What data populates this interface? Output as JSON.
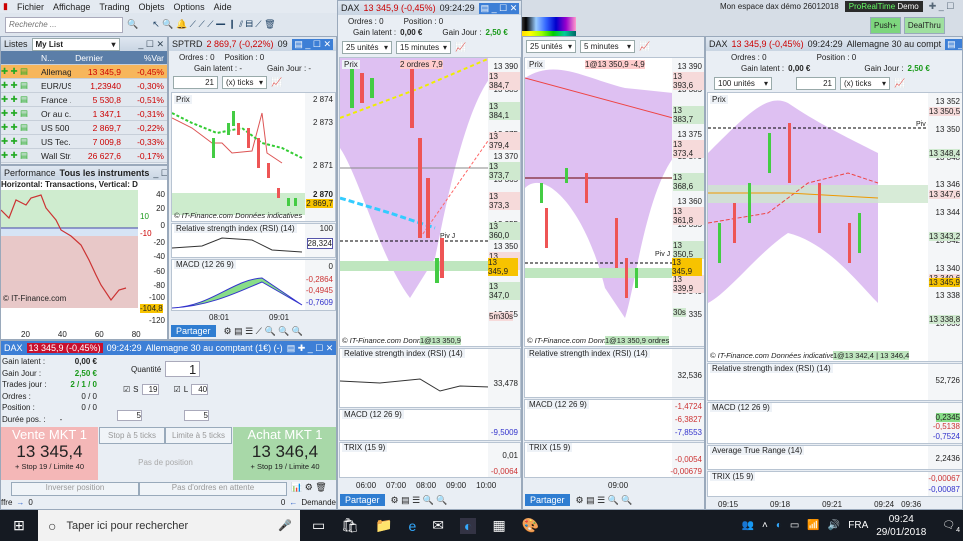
{
  "menu": [
    "Fichier",
    "Affichage",
    "Trading",
    "Objets",
    "Options",
    "Aide"
  ],
  "search": {
    "placeholder": "Recherche ..."
  },
  "workspace": {
    "title": "Mon espace dax démo 26012018",
    "brand": "ProRealTime",
    "mode": "Demo",
    "push": "Push+",
    "dealthru": "DealThru"
  },
  "watchlist": {
    "label": "Listes",
    "name": "My List",
    "cols": [
      "N...",
      "Dernier",
      "%Var"
    ],
    "rows": [
      {
        "n": "Allemag...",
        "last": "13 345,9",
        "var": "-0,45%"
      },
      {
        "n": "EUR/US...",
        "last": "1,23940",
        "var": "-0,30%"
      },
      {
        "n": "France ...",
        "last": "5 530,8",
        "var": "-0,51%"
      },
      {
        "n": "Or au c...",
        "last": "1 347,1",
        "var": "-0,31%"
      },
      {
        "n": "US 500 ...",
        "last": "2 869,7",
        "var": "-0,22%"
      },
      {
        "n": "US Tec...",
        "last": "7 009,8",
        "var": "-0,33%"
      },
      {
        "n": "Wall Str...",
        "last": "26 627,6",
        "var": "-0,17%"
      }
    ]
  },
  "sptrd": {
    "symbol": "SPTRD",
    "price": "2 869,7 (-0,22%)",
    "time": "09",
    "ordres": "Ordres : 0",
    "ordres2": "/ 0",
    "position": "Position : 0",
    "position2": "/ 0",
    "gain_latent": "Gain latent : -",
    "gain_jour": "Gain Jour : -",
    "units": "21",
    "mode": "(x) ticks",
    "prix": "Prix",
    "axis": [
      "2 874",
      "2 873",
      "2 871",
      "2 870",
      "2 869"
    ],
    "last": "2 869,7",
    "copyright": "© IT-Finance.com Données indicatives",
    "rsi": "Relative strength index (RSI) (14)",
    "rsi_axis": [
      "100",
      "50",
      "0"
    ],
    "rsi_val": "28,324",
    "macd": "MACD (12 26 9)",
    "macd_vals": [
      "0",
      "-0,2864",
      "-0,4945",
      "-0,7609"
    ],
    "x": [
      "08:01",
      "09:01"
    ],
    "share": "Partager"
  },
  "perf": {
    "tab": "Performance",
    "filter": "Tous les instruments",
    "title": "Horizontal: Transactions, Vertical: Devise (€)",
    "y": [
      "40",
      "20",
      "0",
      "-20",
      "-40",
      "-60",
      "-80",
      "-100",
      "-120"
    ],
    "x": [
      "20",
      "40",
      "60",
      "80"
    ],
    "last": "-104,8",
    "v1": "10",
    "v2": "-10",
    "copyright": "© IT-Finance.com"
  },
  "order": {
    "symbol": "DAX",
    "price": "13 345,9 (-0,45%)",
    "time": "09:24:29",
    "name": "Allemagne 30 au comptant (1€) (-)",
    "gain_latent_l": "Gain latent :",
    "gain_latent": "0,00 €",
    "gain_jour_l": "Gain Jour :",
    "gain_jour": "2,50 €",
    "trades_l": "Trades jour :",
    "trades": "2 / 1 / 0",
    "ordres_l": "Ordres :",
    "ordres": "0 / 0",
    "position_l": "Position :",
    "position": "0 / 0",
    "duree_l": "Durée pos. :",
    "duree": "-",
    "quantite_l": "Quantité",
    "quantite": "1",
    "s_l": "S",
    "s": "19",
    "l_l": "L",
    "l": "40",
    "step1": "5",
    "step2": "5",
    "stop": "Stop à 5 ticks",
    "limite": "Limite à 5 ticks",
    "no_pos": "Pas de position",
    "sell_label": "Vente MKT 1",
    "sell_price": "13 345,4",
    "sell_sub": "+ Stop 19 / Limite 40",
    "buy_label": "Achat MKT 1",
    "buy_price": "13 346,4",
    "buy_sub": "+ Stop 19 / Limite 40",
    "inverse": "Inverser position",
    "pending": "Pas d'ordres en attente",
    "offre": "ffre",
    "offre_v": "0",
    "demande": "Demande",
    "demande_v": "0"
  },
  "dax15": {
    "symbol": "DAX",
    "price": "13 345,9 (-0,45%)",
    "time": "09:24:29",
    "ordres": "Ordres : 0",
    "position": "Position : 0",
    "gain_latent_l": "Gain latent :",
    "gain_latent": "0,00 €",
    "gain_jour_l": "Gain Jour :",
    "gain_jour": "2,50 €",
    "units": "25 unités",
    "tf": "15 minutes",
    "prix": "Prix",
    "tag": "2 ordres 7,9",
    "axis": [
      "13 390",
      "13 385",
      "13 380",
      "13 375",
      "13 370",
      "13 365",
      "13 360",
      "13 355",
      "13 350",
      "13 345",
      "13 340",
      "13 335"
    ],
    "last": "13 345,9",
    "labels": [
      "13 384,7",
      "13 384,1",
      "13 379,4",
      "13 373,7",
      "13 373,3",
      "13 360,0",
      "13 350,5",
      "13 347,0",
      "5m30s"
    ],
    "pivot": "Piv J",
    "tag2": "1@13 350,9",
    "copyright": "© IT-Finance.com Données",
    "rsi": "Relative strength index (RSI) (14)",
    "rsi_val": "33,478",
    "macd": "MACD (12 26 9)",
    "macd_val": "-9,5009",
    "trix": "TRIX (15 9)",
    "trix_vals": [
      "0,01",
      "-0,0064"
    ],
    "x": [
      "06:00",
      "07:00",
      "08:00",
      "09:00",
      "10:00"
    ],
    "share": "Partager"
  },
  "dax5": {
    "units": "25 unités",
    "tf": "5 minutes",
    "prix": "Prix",
    "tag": "1@13 350,9 -4,9",
    "axis": [
      "13 390",
      "13 385",
      "13 380",
      "13 375",
      "13 370",
      "13 365",
      "13 360",
      "13 355",
      "13 350",
      "13 345",
      "13 340",
      "13 335"
    ],
    "last": "13 345,9",
    "labels": [
      "13 393,6",
      "13 383,7",
      "13 373,4",
      "13 368,6",
      "13 361,8",
      "13 350,5",
      "13 339,9",
      "30s"
    ],
    "pivot": "Piv J",
    "copyright": "© IT-Finance.com Données",
    "tag2": "1@13 350,9 ordres",
    "rsi": "Relative strength index (RSI) (14)",
    "rsi_val": "32,536",
    "macd": "MACD (12 26 9)",
    "macd_vals": [
      "-1,4724",
      "-6,3827",
      "-7,8553"
    ],
    "trix": "TRIX (15 9)",
    "trix_vals": [
      "-0,0054",
      "-0,00679"
    ],
    "x": [
      "09:00"
    ],
    "share": "Partager"
  },
  "daxtick": {
    "symbol": "DAX",
    "price": "13 345,9 (-0,45%)",
    "time": "09:24:29",
    "name": "Allemagne 30 au compt",
    "ordres": "Ordres : 0",
    "position": "Position : 0",
    "gain_latent_l": "Gain latent :",
    "gain_latent": "0,00 €",
    "gain_jour_l": "Gain Jour :",
    "gain_jour": "2,50 €",
    "units": "100 unités",
    "ticks": "21",
    "mode": "(x) ticks",
    "prix": "Prix",
    "axis": [
      "13 352",
      "13 350",
      "13 348",
      "13 346",
      "13 344",
      "13 342",
      "13 340",
      "13 338",
      "13 336"
    ],
    "last": "13 345,9",
    "labels": [
      "13 350,5",
      "13 348,4",
      "13 347,6",
      "13 343,2",
      "13 340,6",
      "13 338,8"
    ],
    "pivot": "Piv J",
    "copyright": "© IT-Finance.com Données indicatives",
    "tag2": "1@13 342,4 | 13 346,4",
    "rsi": "Relative strength index (RSI) (14)",
    "rsi_val": "52,726",
    "macd": "MACD (12 26 9)",
    "macd_vals": [
      "0,2345",
      "-0,5138",
      "-0,7524"
    ],
    "atr": "Average True Range (14)",
    "atr_val": "2,2436",
    "trix": "TRIX (15 9)",
    "trix_vals": [
      "-0,00067",
      "-0,00087"
    ],
    "x": [
      "09:15",
      "09:18",
      "09:21",
      "09:24",
      "09:36"
    ],
    "ind": "21"
  },
  "taskbar": {
    "search": "Taper ici pour rechercher",
    "lang": "FRA",
    "time": "09:24",
    "date": "29/01/2018",
    "notif": "4"
  }
}
